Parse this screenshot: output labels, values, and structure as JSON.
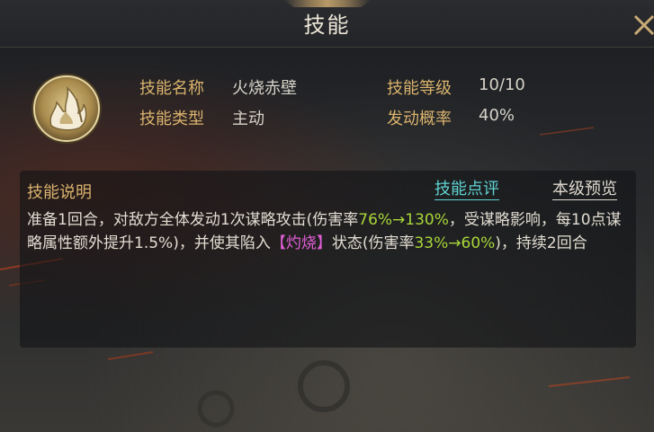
{
  "header": {
    "title": "技能"
  },
  "close_button": {
    "icon": "close-icon"
  },
  "skill": {
    "icon": "flame-skill-icon",
    "name_label": "技能名称",
    "name_value": "火烧赤壁",
    "type_label": "技能类型",
    "type_value": "主动",
    "level_label": "技能等级",
    "level_value": "10/10",
    "chance_label": "发动概率",
    "chance_value": "40%"
  },
  "description": {
    "title": "技能说明",
    "comment_link": "技能点评",
    "preview_link": "本级预览",
    "segments": [
      {
        "text": "准备1回合，对敌方全体发动1次谋略攻击(伤害率",
        "style": "normal"
      },
      {
        "text": "76%→130%",
        "style": "green"
      },
      {
        "text": "，受谋略影响，每10点谋略属性额外提升1.5%)，并使其陷入",
        "style": "normal"
      },
      {
        "text": "【灼烧】",
        "style": "pink"
      },
      {
        "text": "状态(伤害率",
        "style": "normal"
      },
      {
        "text": "33%→60%",
        "style": "green"
      },
      {
        "text": ")，持续2回合",
        "style": "normal"
      }
    ]
  },
  "colors": {
    "label_gold": "#d9b36d",
    "link_cyan": "#5fd3d2",
    "highlight_green": "#a8d63a",
    "highlight_pink": "#e25fd7"
  }
}
